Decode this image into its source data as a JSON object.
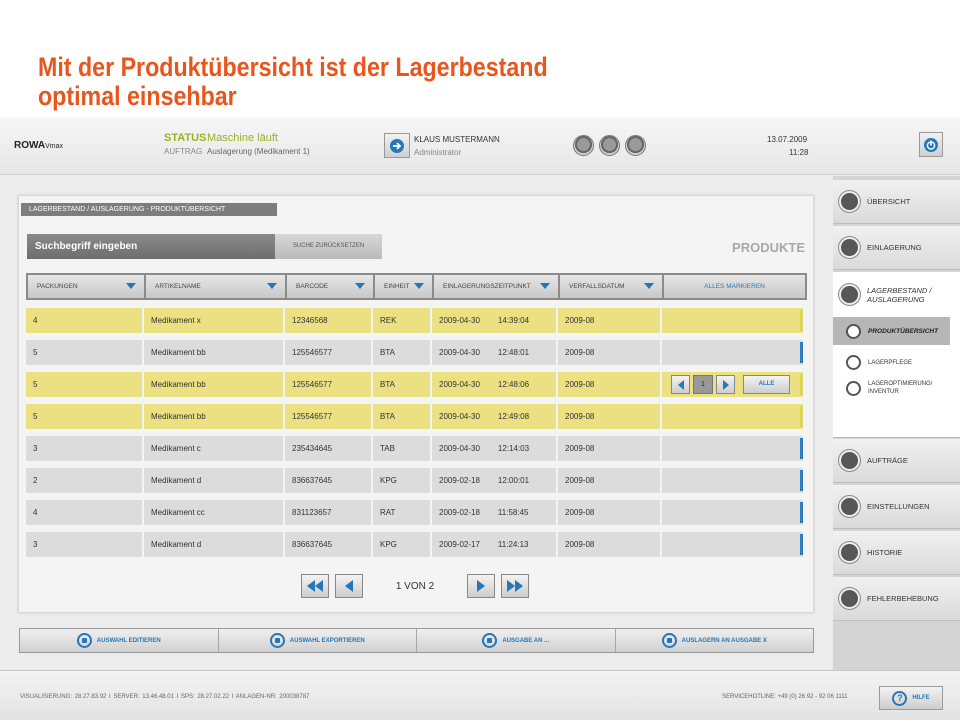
{
  "slide": {
    "title_line1": "Mit der Produktübersicht ist der Lagerbestand",
    "title_line2": "optimal einsehbar"
  },
  "header": {
    "logo": "ROWA",
    "logo_sub": "Vmax",
    "status_label": "STATUS",
    "status_value": "Maschine läuft",
    "auftrag_label": "AUFTRAG",
    "auftrag_value": "Auslagerung (Medikament 1)",
    "user_name": "KLAUS MUSTERMANN",
    "user_role": "Administrator",
    "date": "13.07.2009",
    "time": "11:28"
  },
  "main": {
    "breadcrumb": "LAGERBESTAND / AUSLAGERUNG - PRODUKTÜBERSICHT",
    "search_placeholder": "Suchbegriff eingeben",
    "reset_label": "SUCHE ZURÜCKSETZEN",
    "section_title": "PRODUKTE"
  },
  "table": {
    "columns": [
      "PACKUNGEN",
      "ARTIKELNAME",
      "BARCODE",
      "EINHEIT",
      "EINLAGERUNGSZEITPUNKT",
      "VERFALLSDATUM",
      "ALLES MARKIEREN"
    ],
    "rows": [
      {
        "packungen": "4",
        "artikel": "Medikament x",
        "barcode": "12346568",
        "einheit": "REK",
        "datum": "2009-04-30",
        "zeit": "14:39:04",
        "verfall": "2009-08",
        "highlight": true
      },
      {
        "packungen": "5",
        "artikel": "Medikament bb",
        "barcode": "125546577",
        "einheit": "BTA",
        "datum": "2009-04-30",
        "zeit": "12:48:01",
        "verfall": "2009-08",
        "highlight": false
      },
      {
        "packungen": "5",
        "artikel": "Medikament bb",
        "barcode": "125546577",
        "einheit": "BTA",
        "datum": "2009-04-30",
        "zeit": "12:48:06",
        "verfall": "2009-08",
        "highlight": true
      },
      {
        "packungen": "5",
        "artikel": "Medikament bb",
        "barcode": "125546577",
        "einheit": "BTA",
        "datum": "2009-04-30",
        "zeit": "12:49:08",
        "verfall": "2009-08",
        "highlight": true
      },
      {
        "packungen": "3",
        "artikel": "Medikament c",
        "barcode": "235434645",
        "einheit": "TAB",
        "datum": "2009-04-30",
        "zeit": "12:14:03",
        "verfall": "2009-08",
        "highlight": false
      },
      {
        "packungen": "2",
        "artikel": "Medikament d",
        "barcode": "836637645",
        "einheit": "KPG",
        "datum": "2009-02-18",
        "zeit": "12:00:01",
        "verfall": "2009-08",
        "highlight": false
      },
      {
        "packungen": "4",
        "artikel": "Medikament cc",
        "barcode": "831123657",
        "einheit": "RAT",
        "datum": "2009-02-18",
        "zeit": "11:58:45",
        "verfall": "2009-08",
        "highlight": false
      },
      {
        "packungen": "3",
        "artikel": "Medikament d",
        "barcode": "836637645",
        "einheit": "KPG",
        "datum": "2009-02-17",
        "zeit": "11:24:13",
        "verfall": "2009-08",
        "highlight": false
      }
    ],
    "row_control": {
      "count": "1",
      "alle_label": "ALLE"
    },
    "pager_text": "1 VON 2"
  },
  "actions": [
    "AUSWAHL EDITIEREN",
    "AUSWAHL EXPORTIEREN",
    "AUSGABE AN ...",
    "AUSLAGERN AN AUSGABE X"
  ],
  "footer": {
    "info": "VISUALISIERUNG: 28.27.83.92   I   SERVER: 13.46.48.01   I   SPS: 28.27.02.22   I   ANLAGEN-NR: 200038787",
    "hotline": "SERVICEHOTLINE: +49 (0) 26 92 - 92 06 1111",
    "help_label": "HILFE",
    "help_glyph": "?"
  },
  "sidebar": {
    "uebersicht": "ÜBERSICHT",
    "einlagerung": "EINLAGERUNG",
    "lagerbestand_1": "LAGERBESTAND /",
    "lagerbestand_2": "AUSLAGERUNG",
    "produktuebersicht": "PRODUKTÜBERSICHT",
    "lagerpflege": "LAGERPFLEGE",
    "lageropt_1": "LAGEROPTIMIERUNG/",
    "lageropt_2": "INVENTUR",
    "auftraege": "AUFTRÄGE",
    "einstellungen": "EINSTELLUNGEN",
    "historie": "HISTORIE",
    "fehlerbehebung": "FEHLERBEHEBUNG"
  },
  "colors": {
    "accent": "#2677b8",
    "status_green": "#9ab21f",
    "title_orange": "#e8561e",
    "highlight_row": "#ebe183"
  }
}
